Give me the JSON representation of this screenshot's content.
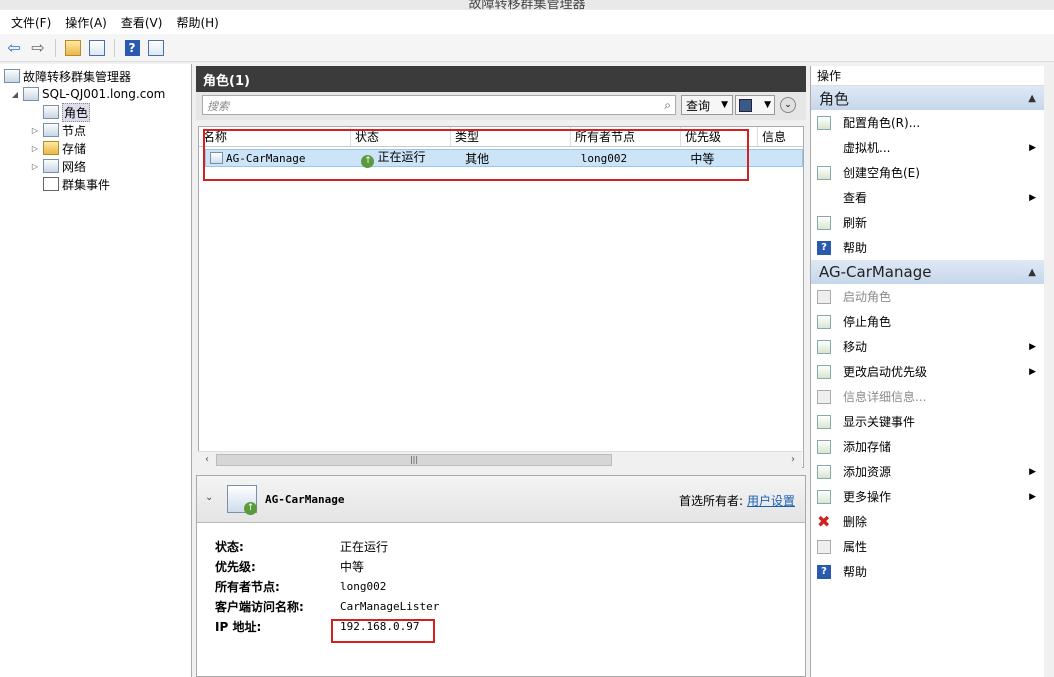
{
  "window": {
    "title": "故障转移群集管理器"
  },
  "menu": [
    "文件(F)",
    "操作(A)",
    "查看(V)",
    "帮助(H)"
  ],
  "tree": {
    "root": "故障转移群集管理器",
    "cluster": "SQL-QJ001.long.com",
    "children": [
      "角色",
      "节点",
      "存储",
      "网络",
      "群集事件"
    ],
    "selected": "角色"
  },
  "roles_panel": {
    "header": "角色(1)",
    "search_placeholder": "搜索",
    "query_button": "查询",
    "columns": [
      "名称",
      "状态",
      "类型",
      "所有者节点",
      "优先级",
      "信息"
    ],
    "rows": [
      {
        "name": "AG-CarManage",
        "status": "正在运行",
        "type": "其他",
        "owner": "long002",
        "priority": "中等",
        "info": ""
      }
    ]
  },
  "detail": {
    "name": "AG-CarManage",
    "preferred_owner_label": "首选所有者:",
    "preferred_owner_link": "用户设置",
    "props": [
      {
        "key": "状态:",
        "value": "正在运行"
      },
      {
        "key": "优先级:",
        "value": "中等"
      },
      {
        "key": "所有者节点:",
        "value": "long002"
      },
      {
        "key": "客户端访问名称:",
        "value": "CarManageLister"
      },
      {
        "key": "IP 地址:",
        "value": "192.168.0.97"
      }
    ]
  },
  "actions": {
    "title": "操作",
    "section1": {
      "title": "角色",
      "items": [
        {
          "label": "配置角色(R)...",
          "icon": "configure-role-icon",
          "submenu": false
        },
        {
          "label": "虚拟机...",
          "icon": "",
          "submenu": true
        },
        {
          "label": "创建空角色(E)",
          "icon": "create-role-icon",
          "submenu": false
        },
        {
          "label": "查看",
          "icon": "",
          "submenu": true
        },
        {
          "label": "刷新",
          "icon": "refresh-icon",
          "submenu": false
        },
        {
          "label": "帮助",
          "icon": "help-icon",
          "submenu": false
        }
      ]
    },
    "section2": {
      "title": "AG-CarManage",
      "items": [
        {
          "label": "启动角色",
          "icon": "start-role-icon",
          "submenu": false,
          "disabled": true
        },
        {
          "label": "停止角色",
          "icon": "stop-role-icon",
          "submenu": false
        },
        {
          "label": "移动",
          "icon": "move-icon",
          "submenu": true
        },
        {
          "label": "更改启动优先级",
          "icon": "priority-icon",
          "submenu": true
        },
        {
          "label": "信息详细信息...",
          "icon": "info-icon",
          "submenu": false,
          "disabled": true
        },
        {
          "label": "显示关键事件",
          "icon": "events-icon",
          "submenu": false
        },
        {
          "label": "添加存储",
          "icon": "add-storage-icon",
          "submenu": false
        },
        {
          "label": "添加资源",
          "icon": "add-resource-icon",
          "submenu": true
        },
        {
          "label": "更多操作",
          "icon": "more-actions-icon",
          "submenu": true
        },
        {
          "label": "删除",
          "icon": "delete-icon",
          "submenu": false
        },
        {
          "label": "属性",
          "icon": "properties-icon",
          "submenu": false
        },
        {
          "label": "帮助",
          "icon": "help-icon",
          "submenu": false
        }
      ]
    }
  }
}
